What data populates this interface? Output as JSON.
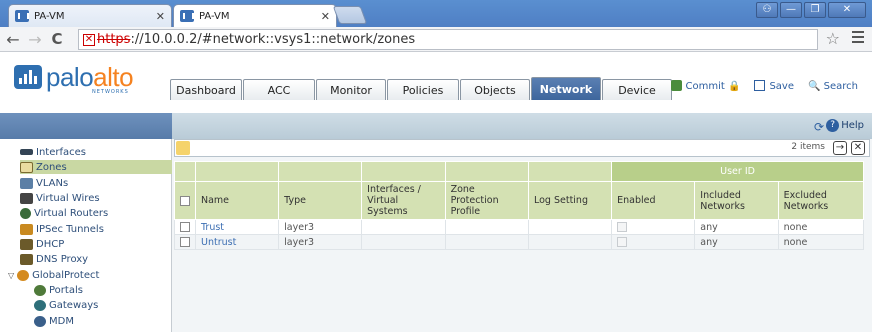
{
  "browser": {
    "tabs": [
      {
        "label": "PA-VM"
      },
      {
        "label": "PA-VM"
      }
    ],
    "url": {
      "protocol": "https",
      "rest": "://10.0.0.2/#network::vsys1::network/zones"
    }
  },
  "app": {
    "logo_main": "palo",
    "logo_accent": "alto",
    "logo_sub": "NETWORKS",
    "nav_tabs": [
      "Dashboard",
      "ACC",
      "Monitor",
      "Policies",
      "Objects",
      "Network",
      "Device"
    ],
    "active_tab": "Network",
    "commit_label": "Commit",
    "save_label": "Save",
    "search_label": "Search",
    "help_label": "Help"
  },
  "sidebar": {
    "items": [
      {
        "label": "Interfaces"
      },
      {
        "label": "Zones"
      },
      {
        "label": "VLANs"
      },
      {
        "label": "Virtual Wires"
      },
      {
        "label": "Virtual Routers"
      },
      {
        "label": "IPSec Tunnels"
      },
      {
        "label": "DHCP"
      },
      {
        "label": "DNS Proxy"
      },
      {
        "label": "GlobalProtect"
      },
      {
        "label": "Portals"
      },
      {
        "label": "Gateways"
      },
      {
        "label": "MDM"
      }
    ],
    "selected": "Zones"
  },
  "grid": {
    "item_count": "2 items",
    "group_header": "User ID",
    "columns": [
      "Name",
      "Type",
      "Interfaces / Virtual Systems",
      "Zone Protection Profile",
      "Log Setting",
      "Enabled",
      "Included Networks",
      "Excluded Networks"
    ],
    "rows": [
      {
        "name": "Trust",
        "type": "layer3",
        "interfaces": "",
        "zpp": "",
        "log": "",
        "included": "any",
        "excluded": "none"
      },
      {
        "name": "Untrust",
        "type": "layer3",
        "interfaces": "",
        "zpp": "",
        "log": "",
        "included": "any",
        "excluded": "none"
      }
    ]
  }
}
